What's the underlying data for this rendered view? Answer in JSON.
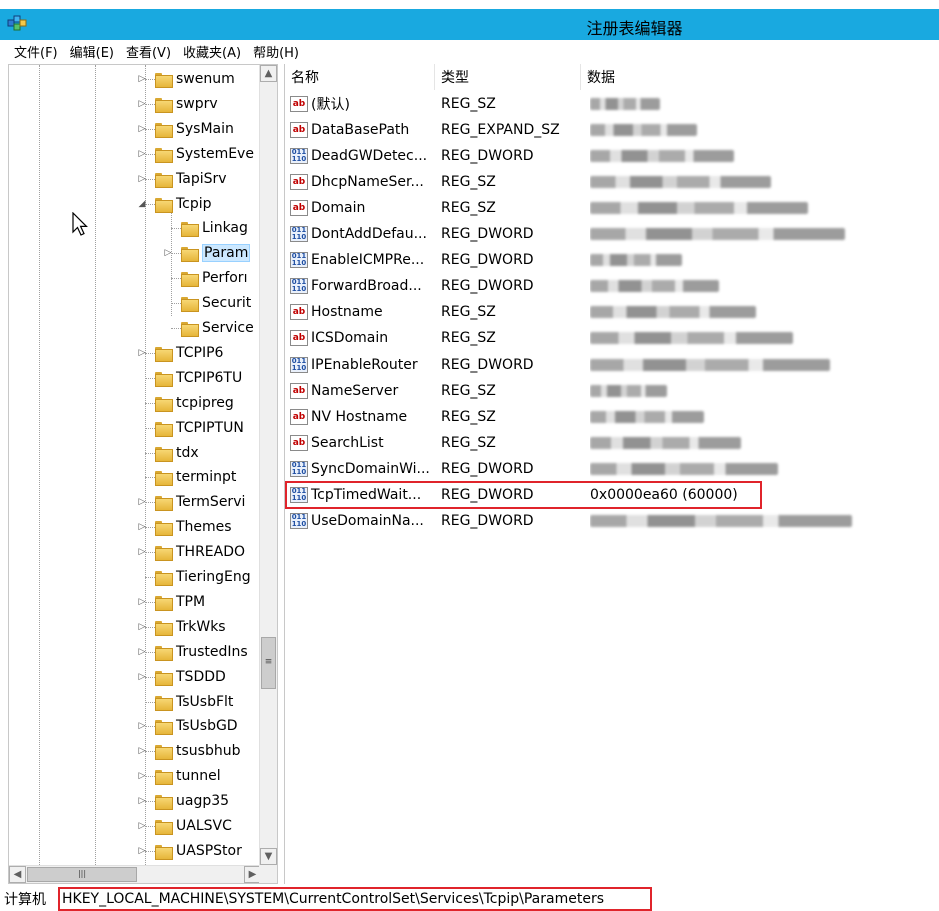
{
  "window": {
    "title": "注册表编辑器",
    "accent_color": "#19a9e0",
    "app_icon": "regedit-icon"
  },
  "menu": [
    "文件(F)",
    "编辑(E)",
    "查看(V)",
    "收藏夹(A)",
    "帮助(H)"
  ],
  "tree": {
    "items": [
      {
        "label": "swenum",
        "level": 0,
        "expander": "collapsed"
      },
      {
        "label": "swprv",
        "level": 0,
        "expander": "collapsed"
      },
      {
        "label": "SysMain",
        "level": 0,
        "expander": "collapsed"
      },
      {
        "label": "SystemEve",
        "level": 0,
        "expander": "collapsed"
      },
      {
        "label": "TapiSrv",
        "level": 0,
        "expander": "collapsed"
      },
      {
        "label": "Tcpip",
        "level": 0,
        "expander": "expanded"
      },
      {
        "label": "Linkag",
        "level": 1,
        "expander": "none"
      },
      {
        "label": "Param",
        "level": 1,
        "expander": "collapsed",
        "selected": true
      },
      {
        "label": "Perforı",
        "level": 1,
        "expander": "none"
      },
      {
        "label": "Securit",
        "level": 1,
        "expander": "none"
      },
      {
        "label": "Service",
        "level": 1,
        "expander": "none"
      },
      {
        "label": "TCPIP6",
        "level": 0,
        "expander": "collapsed"
      },
      {
        "label": "TCPIP6TU",
        "level": 0,
        "expander": "none"
      },
      {
        "label": "tcpipreg",
        "level": 0,
        "expander": "none"
      },
      {
        "label": "TCPIPTUN",
        "level": 0,
        "expander": "none"
      },
      {
        "label": "tdx",
        "level": 0,
        "expander": "none"
      },
      {
        "label": "terminpt",
        "level": 0,
        "expander": "none"
      },
      {
        "label": "TermServi",
        "level": 0,
        "expander": "collapsed"
      },
      {
        "label": "Themes",
        "level": 0,
        "expander": "collapsed"
      },
      {
        "label": "THREADO",
        "level": 0,
        "expander": "collapsed"
      },
      {
        "label": "TieringEng",
        "level": 0,
        "expander": "none"
      },
      {
        "label": "TPM",
        "level": 0,
        "expander": "collapsed"
      },
      {
        "label": "TrkWks",
        "level": 0,
        "expander": "collapsed"
      },
      {
        "label": "TrustedIns",
        "level": 0,
        "expander": "collapsed"
      },
      {
        "label": "TSDDD",
        "level": 0,
        "expander": "collapsed"
      },
      {
        "label": "TsUsbFlt",
        "level": 0,
        "expander": "none"
      },
      {
        "label": "TsUsbGD",
        "level": 0,
        "expander": "collapsed"
      },
      {
        "label": "tsusbhub",
        "level": 0,
        "expander": "collapsed"
      },
      {
        "label": "tunnel",
        "level": 0,
        "expander": "collapsed"
      },
      {
        "label": "uagp35",
        "level": 0,
        "expander": "collapsed"
      },
      {
        "label": "UALSVC",
        "level": 0,
        "expander": "collapsed"
      },
      {
        "label": "UASPStor",
        "level": 0,
        "expander": "collapsed"
      }
    ]
  },
  "values": {
    "columns": {
      "name": "名称",
      "type": "类型",
      "data": "数据"
    },
    "rows": [
      {
        "name": "(默认)",
        "type": "REG_SZ",
        "icon": "string-value-icon",
        "data": ""
      },
      {
        "name": "DataBasePath",
        "type": "REG_EXPAND_SZ",
        "icon": "string-value-icon",
        "data": ""
      },
      {
        "name": "DeadGWDetec...",
        "type": "REG_DWORD",
        "icon": "dword-value-icon",
        "data": ""
      },
      {
        "name": "DhcpNameSer...",
        "type": "REG_SZ",
        "icon": "string-value-icon",
        "data": ""
      },
      {
        "name": "Domain",
        "type": "REG_SZ",
        "icon": "string-value-icon",
        "data": ""
      },
      {
        "name": "DontAddDefau...",
        "type": "REG_DWORD",
        "icon": "dword-value-icon",
        "data": ""
      },
      {
        "name": "EnableICMPRe...",
        "type": "REG_DWORD",
        "icon": "dword-value-icon",
        "data": ""
      },
      {
        "name": "ForwardBroad...",
        "type": "REG_DWORD",
        "icon": "dword-value-icon",
        "data": ""
      },
      {
        "name": "Hostname",
        "type": "REG_SZ",
        "icon": "string-value-icon",
        "data": ""
      },
      {
        "name": "ICSDomain",
        "type": "REG_SZ",
        "icon": "string-value-icon",
        "data": ""
      },
      {
        "name": "IPEnableRouter",
        "type": "REG_DWORD",
        "icon": "dword-value-icon",
        "data": ""
      },
      {
        "name": "NameServer",
        "type": "REG_SZ",
        "icon": "string-value-icon",
        "data": ""
      },
      {
        "name": "NV Hostname",
        "type": "REG_SZ",
        "icon": "string-value-icon",
        "data": ""
      },
      {
        "name": "SearchList",
        "type": "REG_SZ",
        "icon": "string-value-icon",
        "data": ""
      },
      {
        "name": "SyncDomainWi...",
        "type": "REG_DWORD",
        "icon": "dword-value-icon",
        "data": ""
      },
      {
        "name": "TcpTimedWait...",
        "type": "REG_DWORD",
        "icon": "dword-value-icon",
        "data": "0x0000ea60 (60000)",
        "highlighted": true
      },
      {
        "name": "UseDomainNa...",
        "type": "REG_DWORD",
        "icon": "dword-value-icon",
        "data": ""
      }
    ],
    "highlight_color": "#e0242b"
  },
  "statusbar": {
    "computer": "计算机",
    "path": "HKEY_LOCAL_MACHINE\\SYSTEM\\CurrentControlSet\\Services\\Tcpip\\Parameters"
  }
}
